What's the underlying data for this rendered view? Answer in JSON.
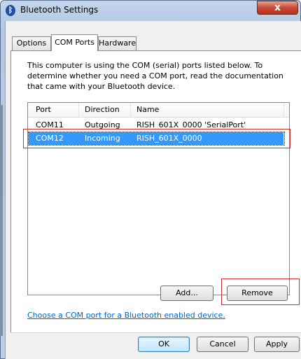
{
  "window": {
    "title": "Bluetooth Settings",
    "icon": "bluetooth-icon",
    "close_glyph": "x"
  },
  "tabs": [
    {
      "label": "Options",
      "active": false
    },
    {
      "label": "COM Ports",
      "active": true
    },
    {
      "label": "Hardware",
      "active": false
    }
  ],
  "description": "This computer is using the COM (serial) ports listed below. To determine whether you need a COM port, read the documentation that came with your Bluetooth device.",
  "ports_table": {
    "columns": [
      "Port",
      "Direction",
      "Name"
    ],
    "rows": [
      {
        "port": "COM11",
        "direction": "Outgoing",
        "name": "RISH_601X_0000 'SerialPort'",
        "selected": false
      },
      {
        "port": "COM12",
        "direction": "Incoming",
        "name": "RISH_601X_0000",
        "selected": true
      }
    ]
  },
  "buttons": {
    "add": "Add...",
    "remove": "Remove",
    "ok": "OK",
    "cancel": "Cancel",
    "apply": "Apply"
  },
  "link": "Choose a COM port for a Bluetooth enabled device.",
  "colors": {
    "selection": "#3399ff",
    "highlight_box": "#d32f2f",
    "link": "#0066cc"
  }
}
